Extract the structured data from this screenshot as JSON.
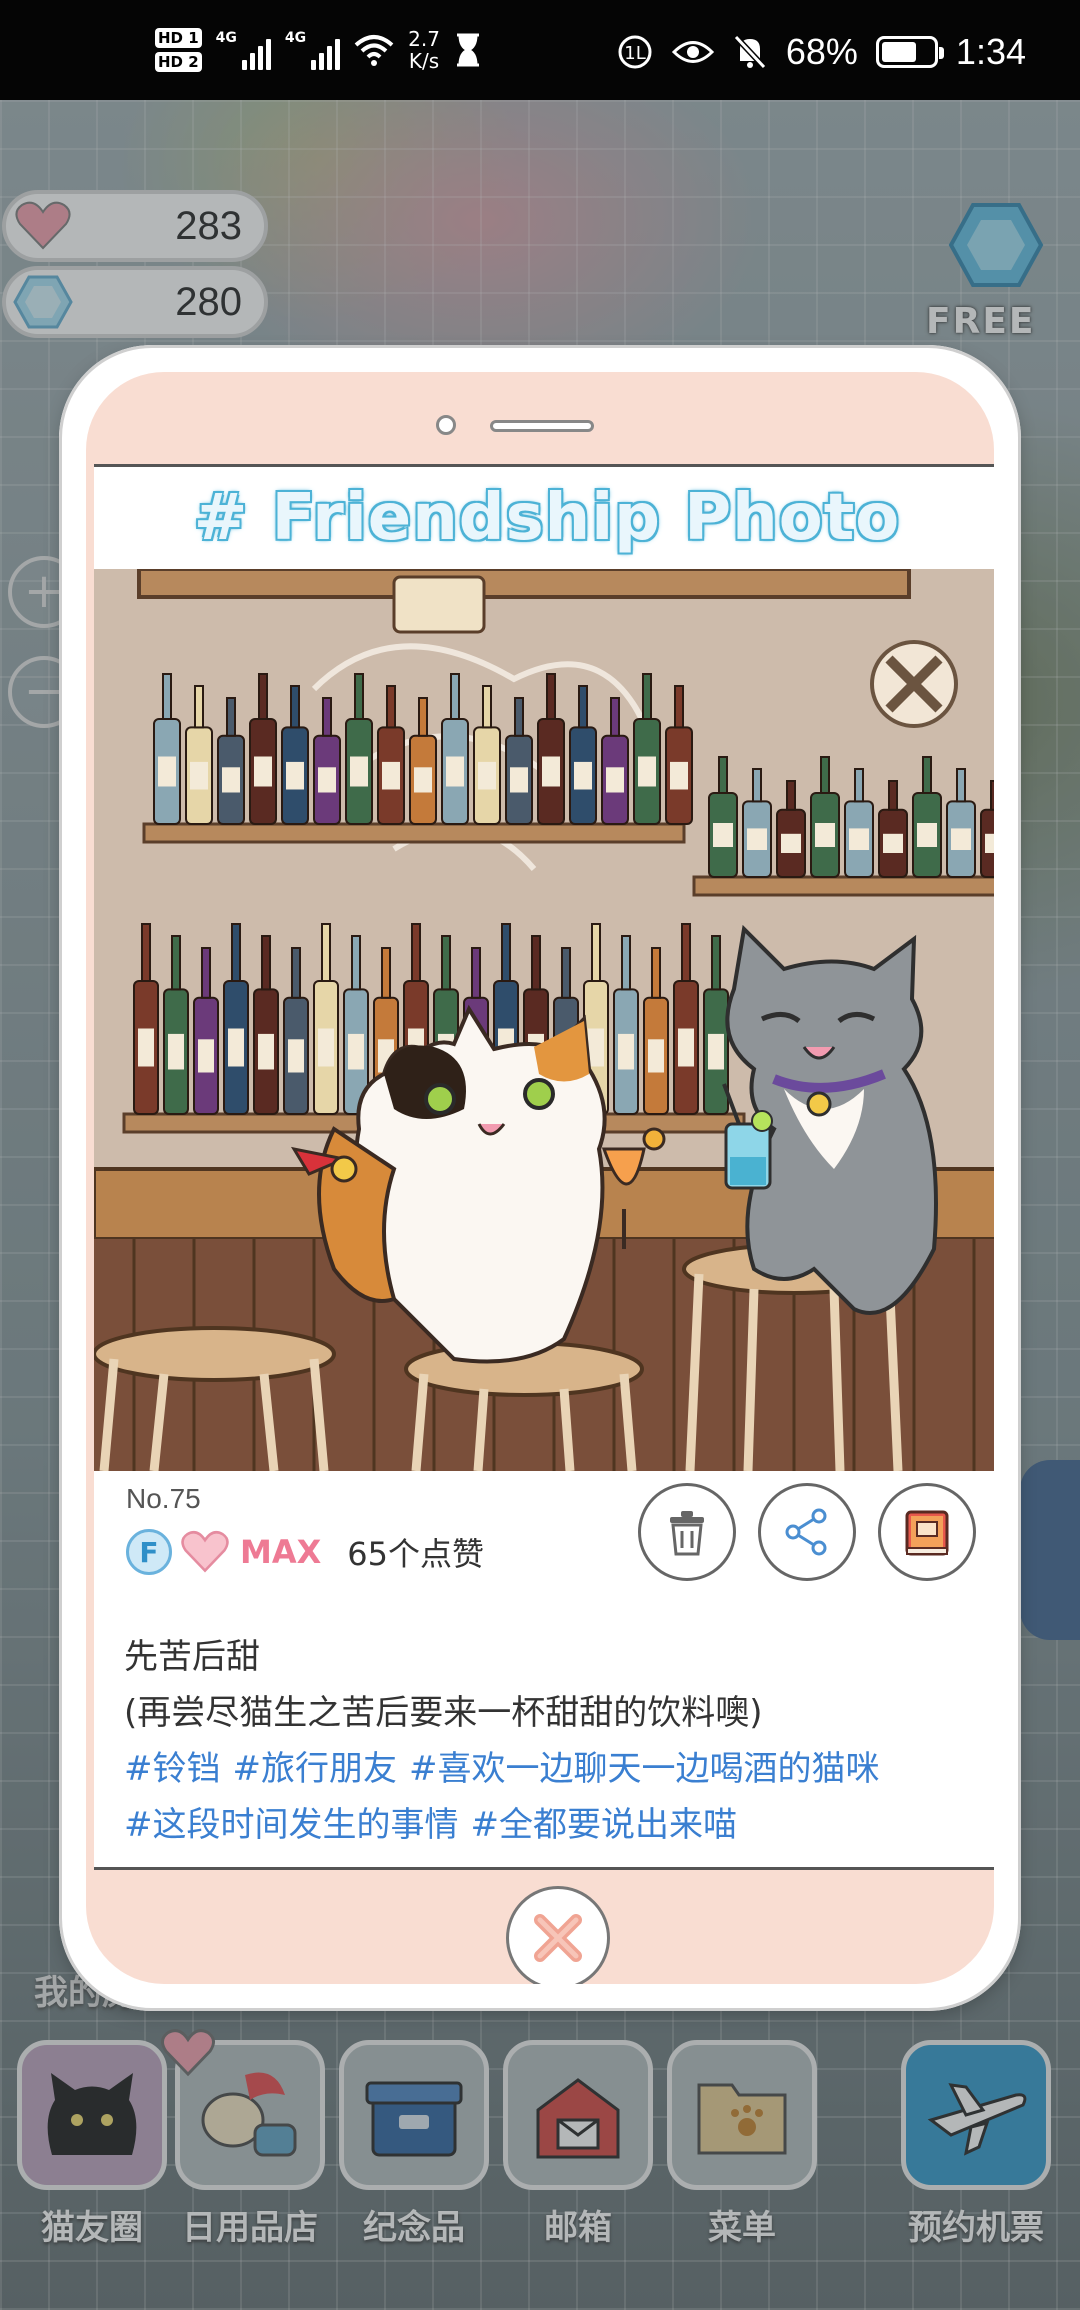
{
  "status_bar": {
    "hd1": "HD 1",
    "hd2": "HD 2",
    "net1": "4G",
    "net2": "4G",
    "speed_value": "2.7",
    "speed_unit": "K/s",
    "battery_percent": "68%",
    "battery_level": 0.68,
    "time": "1:34"
  },
  "currency": {
    "hearts": "283",
    "gems": "280"
  },
  "free_badge": "FREE",
  "zoom": {
    "plus": "+",
    "minus": "−"
  },
  "photo_card": {
    "title": "# Friendship Photo",
    "number": "No.75",
    "level_badge": "F",
    "level_label": "MAX",
    "likes": "65个点赞",
    "caption_title": "先苦后甜",
    "caption_sub": "(再尝尽猫生之苦后要来一杯甜甜的饮料噢)",
    "tags": [
      "#铃铛",
      "#旅行朋友",
      "#喜欢一边聊天一边喝酒的猫咪",
      "#这段时间发生的事情",
      "#全都要说出来喵"
    ],
    "actions": [
      "delete-icon",
      "share-icon",
      "album-icon"
    ]
  },
  "mine_label": "我的房",
  "bottom_nav": [
    {
      "label": "猫友圈",
      "icon": "cat-circle-icon"
    },
    {
      "label": "日用品店",
      "icon": "shop-icon"
    },
    {
      "label": "纪念品",
      "icon": "souvenir-icon"
    },
    {
      "label": "邮箱",
      "icon": "mailbox-icon"
    },
    {
      "label": "菜单",
      "icon": "menu-folder-icon"
    },
    {
      "label": "预约机票",
      "icon": "airplane-icon"
    }
  ],
  "colors": {
    "frame_pink": "#f9ddd2",
    "title_blue": "#4eb3d6",
    "tag_blue": "#3a7fd1",
    "heart_pink": "#f1a3b3"
  }
}
